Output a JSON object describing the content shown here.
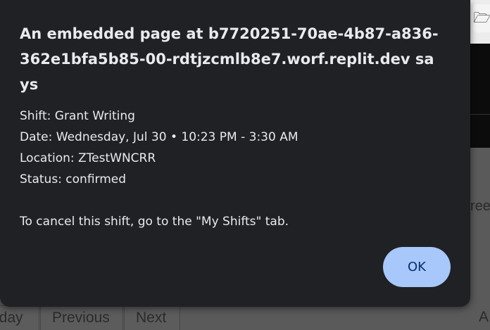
{
  "background": {
    "nav": {
      "today_label": "oday",
      "previous_label": "Previous",
      "next_label": "Next",
      "right_label": "A"
    },
    "partial_text": "ree"
  },
  "dialog": {
    "title": "An embedded page at b7720251-70ae-4b87-a836-362e1bfa5b85-00-rdtjzcmlb8e7.worf.replit.dev says",
    "lines": [
      "Shift: Grant Writing",
      "Date: Wednesday, Jul 30 • 10:23 PM - 3:30 AM",
      "Location: ZTestWNCRR",
      "Status: confirmed",
      "To cancel this shift, go to the \"My Shifts\" tab."
    ],
    "ok_label": "OK"
  },
  "colors": {
    "dialog_bg": "#202124",
    "dialog_text": "#e8eaed",
    "button_bg": "#a8c7fa",
    "button_text": "#062e6f",
    "overlay": "#5a5a5a"
  }
}
